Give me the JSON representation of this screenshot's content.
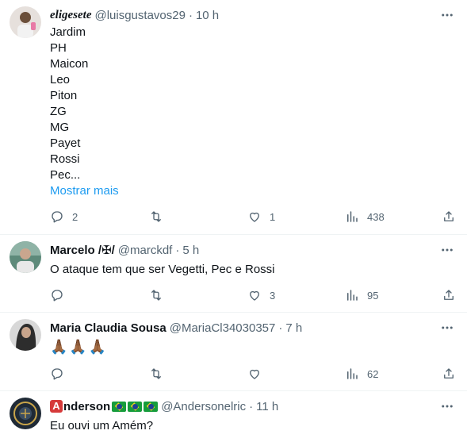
{
  "tweets": [
    {
      "name": "eligesete",
      "handle": "@luisgustavos29",
      "separator": "·",
      "time": "10 h",
      "lines": [
        "Jardim",
        "PH",
        "Maicon",
        "Leo",
        "Piton",
        "ZG",
        "MG",
        "Payet",
        "Rossi",
        "Pec..."
      ],
      "show_more": "Mostrar mais",
      "replies": "2",
      "retweets": "",
      "likes": "1",
      "views": "438"
    },
    {
      "name": "Marcelo /✠/",
      "handle": "@marckdf",
      "separator": "·",
      "time": "5 h",
      "text": "O ataque tem que ser Vegetti, Pec e Rossi",
      "replies": "",
      "retweets": "",
      "likes": "3",
      "views": "95"
    },
    {
      "name": "Maria Claudia Sousa",
      "handle": "@MariaCl34030357",
      "separator": "·",
      "time": "7 h",
      "text": "🙏🏾🙏🏾🙏🏾",
      "replies": "",
      "retweets": "",
      "likes": "",
      "views": "62"
    },
    {
      "name_badge": "A",
      "name": "nderson",
      "handle": "@Andersonelric",
      "separator": "·",
      "time": "11 h",
      "text": "Eu ouvi um Amém?"
    }
  ],
  "colors": {
    "text": "#0f1419",
    "secondary": "#536471",
    "link": "#1d9bf0",
    "border": "#eff3f4"
  },
  "icons": [
    "reply-icon",
    "retweet-icon",
    "like-icon",
    "views-icon",
    "share-icon",
    "more-icon"
  ]
}
